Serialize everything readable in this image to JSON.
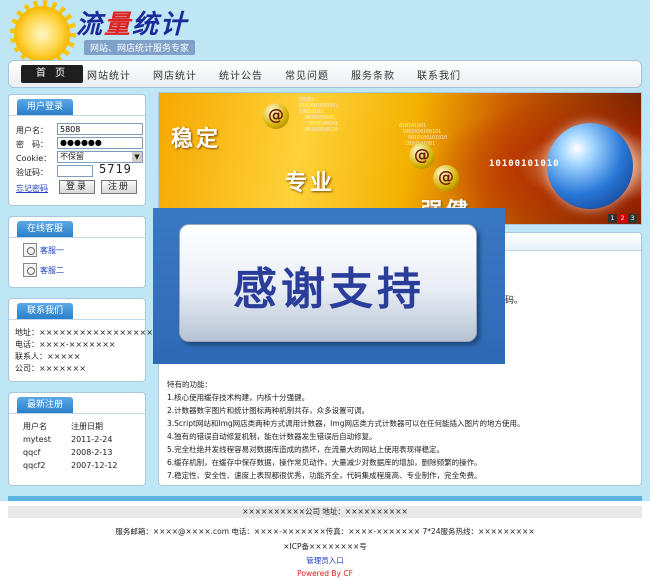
{
  "header": {
    "logo_title_a": "流",
    "logo_title_b": "量",
    "logo_title_c": "统计",
    "logo_slogan": "网站、网店统计服务专家"
  },
  "nav": {
    "items": [
      "首 页",
      "网站统计",
      "网店统计",
      "统计公告",
      "常见问题",
      "服务条款",
      "联系我们"
    ]
  },
  "login": {
    "title": "用户登录",
    "username_label": "用户名：",
    "username_value": "5808",
    "password_label": "密　码：",
    "password_value": "●●●●●●",
    "cookie_label": "Cookie：",
    "cookie_value": "不保留",
    "captcha_label": "验证码：",
    "captcha_value": "5719",
    "forgot_label": "忘记密码",
    "login_button": "登录",
    "register_button": "注册"
  },
  "service": {
    "title": "在线客服",
    "items": [
      "客服一",
      "客服二"
    ]
  },
  "contact": {
    "title": "联系我们",
    "address": "地址：××××××××××××××××××",
    "phone": "电话：××××-×××××××",
    "person": "联系人：×××××",
    "company": "公司：×××××××"
  },
  "registrations": {
    "title": "最新注册",
    "headers": [
      "用户名",
      "注册日期"
    ],
    "rows": [
      [
        "mytest",
        "2011-2-24"
      ],
      [
        "qqcf",
        "2008-2-13"
      ],
      [
        "qqcf2",
        "2007-12-12"
      ]
    ]
  },
  "banner": {
    "word1": "稳定",
    "word2": "专业",
    "word3": "强健",
    "code_text": "10100101010",
    "pager": [
      "1",
      "2",
      "3"
    ]
  },
  "content": {
    "fragment": "码。",
    "features_title": "特有的功能：",
    "features": [
      "1.核心使用缓存技术构建，内核十分强健。",
      "2.计数器数字图片和统计图标两种机制共存，众多设置可调。",
      "3.Script网站和Img网店类两种方式调用计数器，Img网店类方式计数器可以在任何能插入图片的地方使用。",
      "4.独有的错误自动修复机制，能在计数器发生错误后自动修复。",
      "5.完全杜绝并发线程容易对数据库造成的损坏，在流量大的网站上使用表现得稳定。",
      "6.缓存机制，在缓存中保存数据，操作常见动作，大量减少对数据库的增加，删除频繁的操作。",
      "7.稳定性、安全性、速度上表现都很优秀，功能齐全，代码集成程度高、专业制作，完全免费。"
    ]
  },
  "overlay": {
    "text": "感谢支持"
  },
  "footer": {
    "company": "××××××××××公司 地址：××××××××××",
    "contact": "服务邮箱：××××@××××.com 电话：××××-×××××××传真：××××-××××××× 7*24服务热线：×××××××××",
    "icp": "×ICP备××××××××号",
    "admin_link": "管理员入口",
    "powered": "Powered By CF"
  }
}
